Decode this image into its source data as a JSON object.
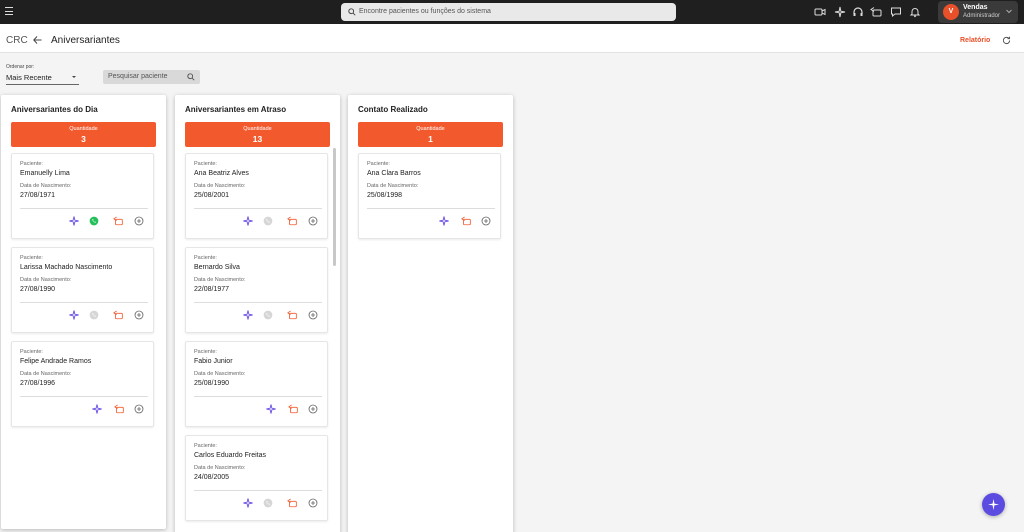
{
  "topbar": {
    "search_placeholder": "Encontre pacientes ou funções do sistema",
    "user_name": "Vendas",
    "user_role": "Administrador",
    "user_initial": "V"
  },
  "header": {
    "section": "CRC",
    "title": "Aniversariantes",
    "report_label": "Relatório"
  },
  "filters": {
    "order_label": "Ordenar por:",
    "order_value": "Mais Recente",
    "search_placeholder": "Pesquisar paciente"
  },
  "labels": {
    "patient": "Paciente:",
    "birth_date": "Data de Nascimento:",
    "quantity": "Quantidade"
  },
  "columns": [
    {
      "title": "Aniversariantes do Dia",
      "count": "3",
      "cards": [
        {
          "name": "Emanuelly Lima",
          "birth": "27/08/1971",
          "whatsapp": "active"
        },
        {
          "name": "Larissa Machado Nascimento",
          "birth": "27/08/1990",
          "whatsapp": "inactive"
        },
        {
          "name": "Felipe Andrade Ramos",
          "birth": "27/08/1996",
          "whatsapp": "none"
        }
      ]
    },
    {
      "title": "Aniversariantes em Atraso",
      "count": "13",
      "cards": [
        {
          "name": "Ana Beatriz Alves",
          "birth": "25/08/2001",
          "whatsapp": "inactive"
        },
        {
          "name": "Bernardo Silva",
          "birth": "22/08/1977",
          "whatsapp": "inactive"
        },
        {
          "name": "Fabio Junior",
          "birth": "25/08/1990",
          "whatsapp": "none"
        },
        {
          "name": "Carlos Eduardo Freitas",
          "birth": "24/08/2005",
          "whatsapp": "inactive"
        }
      ]
    },
    {
      "title": "Contato Realizado",
      "count": "1",
      "cards": [
        {
          "name": "Ana Clara Barros",
          "birth": "25/08/1998",
          "whatsapp": "none"
        }
      ]
    }
  ],
  "colors": {
    "accent": "#f25a2e",
    "purple": "#6b4ee6",
    "whatsapp": "#25c05a",
    "topbar": "#1f1f1f"
  }
}
